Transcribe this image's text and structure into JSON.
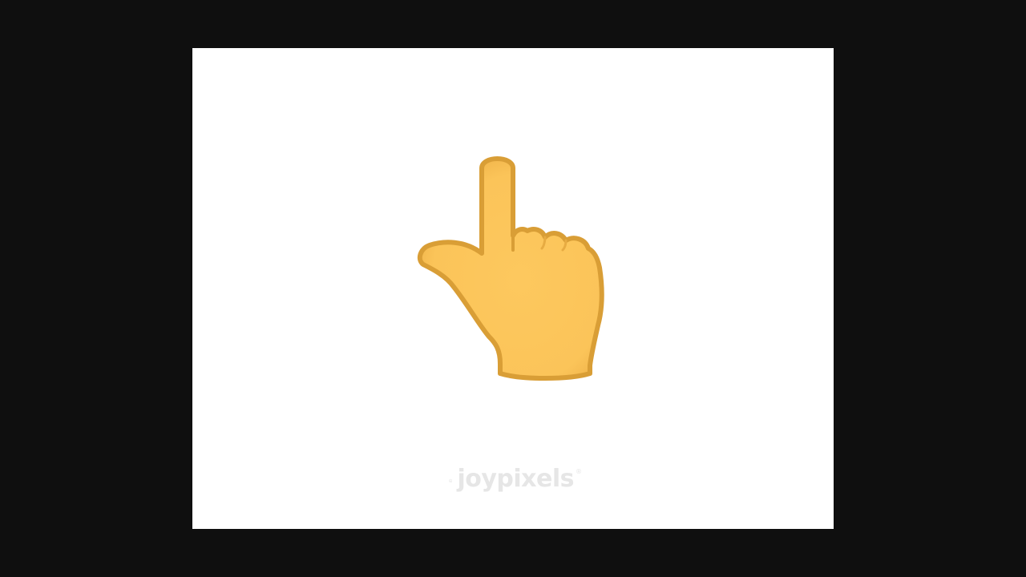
{
  "image": {
    "subject_icon": "backhand-index-pointing-up-icon",
    "colors": {
      "outer_background": "#0f0f0f",
      "card_background": "#ffffff",
      "skin": "#fcc55b",
      "outline": "#d99e36",
      "watermark": "#e6e6e6"
    }
  },
  "watermark": {
    "brand": "joypixels",
    "registered_mark": "®",
    "icon": "joypixels-logo-icon"
  }
}
